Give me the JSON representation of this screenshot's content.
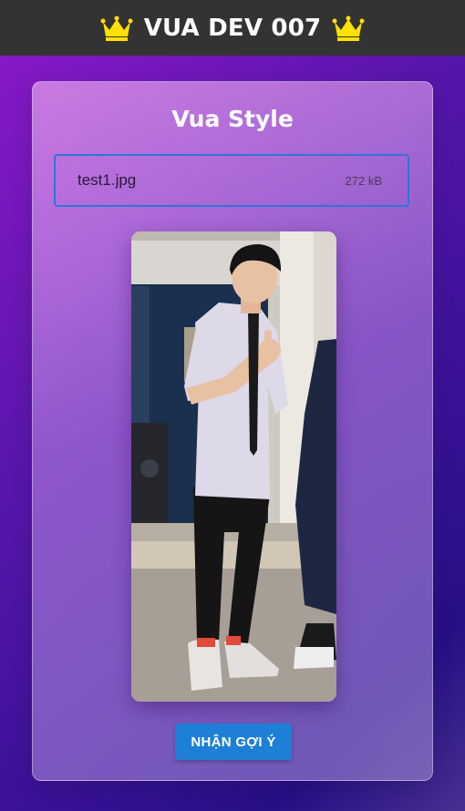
{
  "header": {
    "title": "VUA DEV 007",
    "left_icon": "crown-icon",
    "right_icon": "crown-icon",
    "background": "#333333",
    "crown_color": "#ffe100"
  },
  "card": {
    "title": "Vua Style"
  },
  "upload": {
    "file_name": "test1.jpg",
    "file_size": "272 kB",
    "border_color": "#2f74d8"
  },
  "preview": {
    "icon": "photo-preview"
  },
  "actions": {
    "submit_label": "NHẬN GỢI Ý",
    "button_color": "#1e7fd6"
  }
}
